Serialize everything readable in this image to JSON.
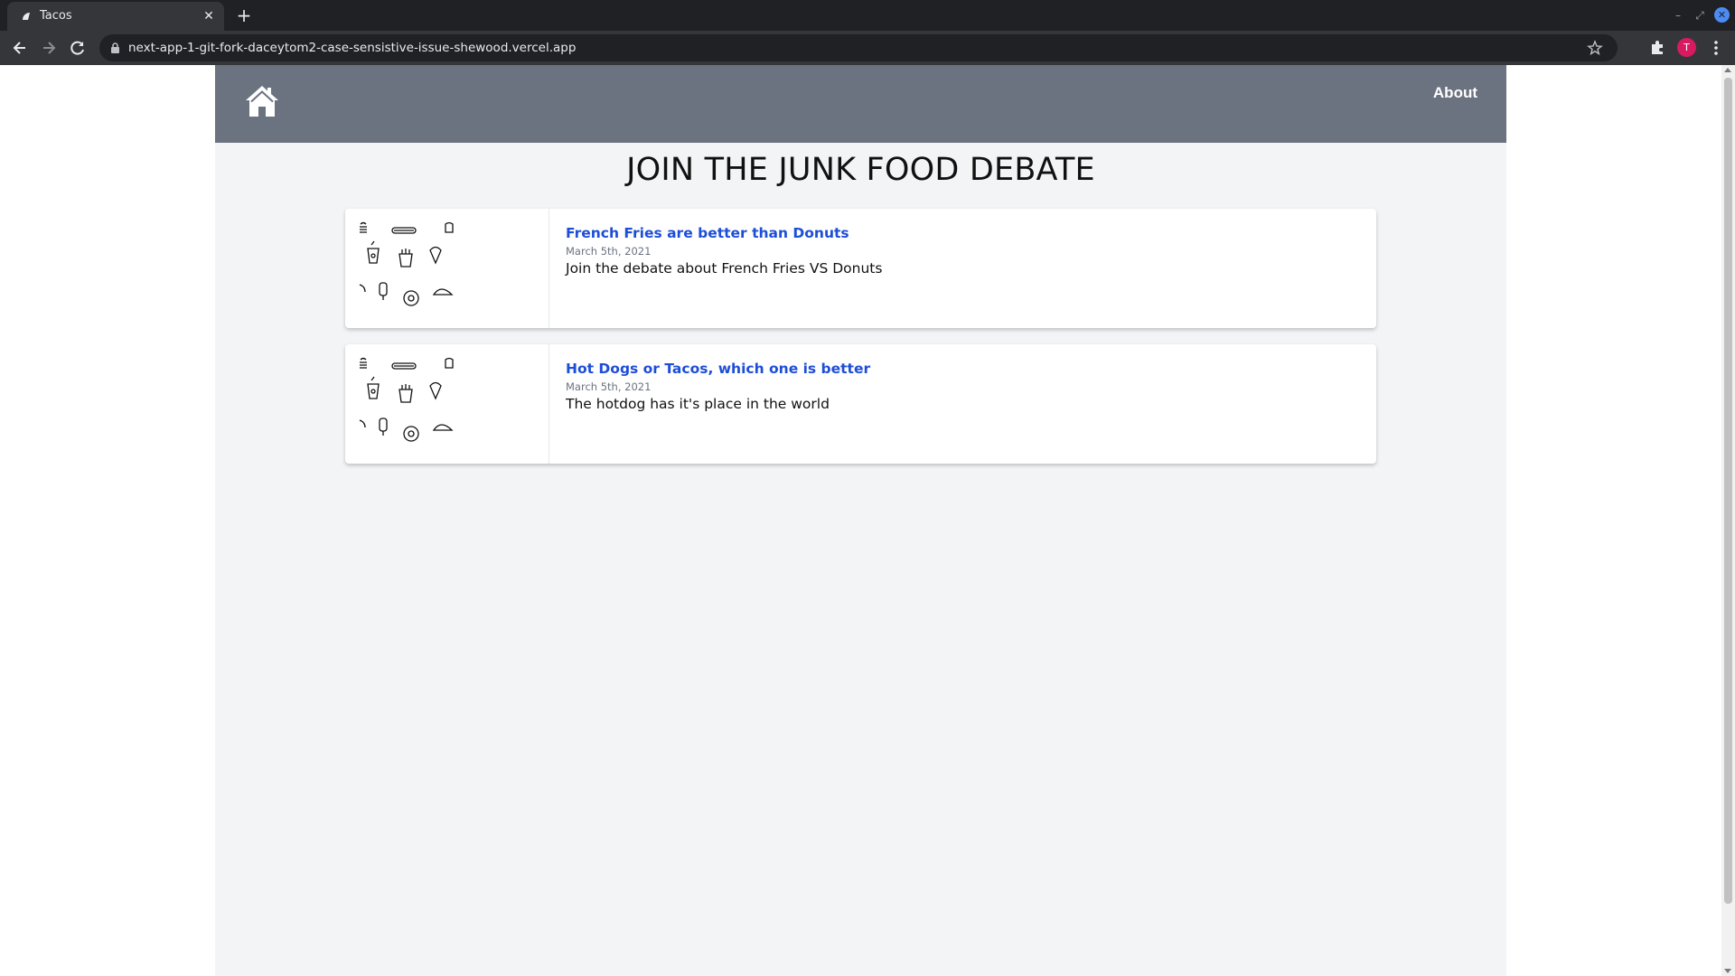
{
  "browser": {
    "tab_title": "Tacos",
    "url": "next-app-1-git-fork-daceytom2-case-sensistive-issue-shewood.vercel.app",
    "avatar_letter": "T",
    "icons": [
      "back-icon",
      "forward-icon",
      "reload-icon",
      "lock-icon",
      "star-icon",
      "extensions-icon",
      "menu-icon"
    ]
  },
  "header": {
    "about_label": "About",
    "home_icon": "home-icon",
    "background_color": "#6b7280"
  },
  "main": {
    "title": "JOIN THE JUNK FOOD DEBATE",
    "posts": [
      {
        "title": "French Fries are better than Donuts",
        "date": "March 5th, 2021",
        "description": "Join the debate about French Fries VS Donuts"
      },
      {
        "title": "Hot Dogs or Tacos, which one is better",
        "date": "March 5th, 2021",
        "description": "The hotdog has it's place in the world"
      }
    ]
  },
  "colors": {
    "page_background": "#f3f4f6",
    "link": "#1d4ed8"
  }
}
